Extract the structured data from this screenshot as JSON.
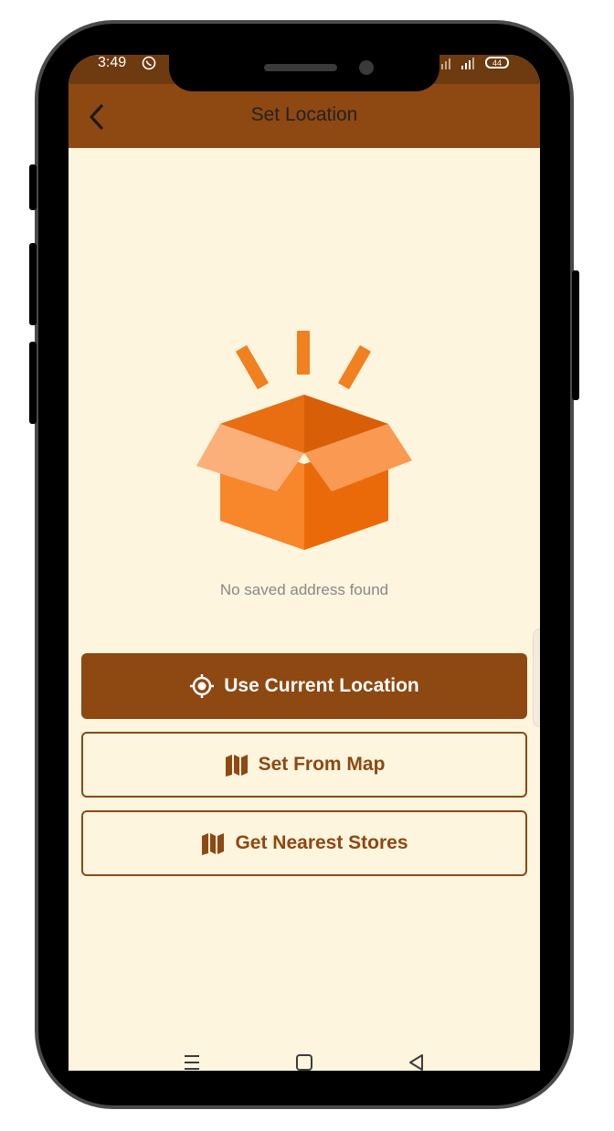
{
  "status_bar": {
    "time": "3:49",
    "battery": "44"
  },
  "header": {
    "title": "Set Location",
    "back_icon": "chevron-left-icon"
  },
  "empty_state": {
    "message": "No saved address found",
    "icon": "open-box-icon"
  },
  "actions": {
    "current_location": {
      "label": "Use Current Location",
      "icon": "crosshair-target-icon"
    },
    "set_from_map": {
      "label": "Set From Map",
      "icon": "map-icon"
    },
    "nearest_stores": {
      "label": "Get Nearest Stores",
      "icon": "map-icon"
    }
  },
  "nav": {
    "items": [
      "menu-icon",
      "home-square-icon",
      "back-triangle-icon"
    ]
  },
  "colors": {
    "primary": "#8e4812",
    "background": "#fdf5dd",
    "box_orange": "#f08020"
  }
}
